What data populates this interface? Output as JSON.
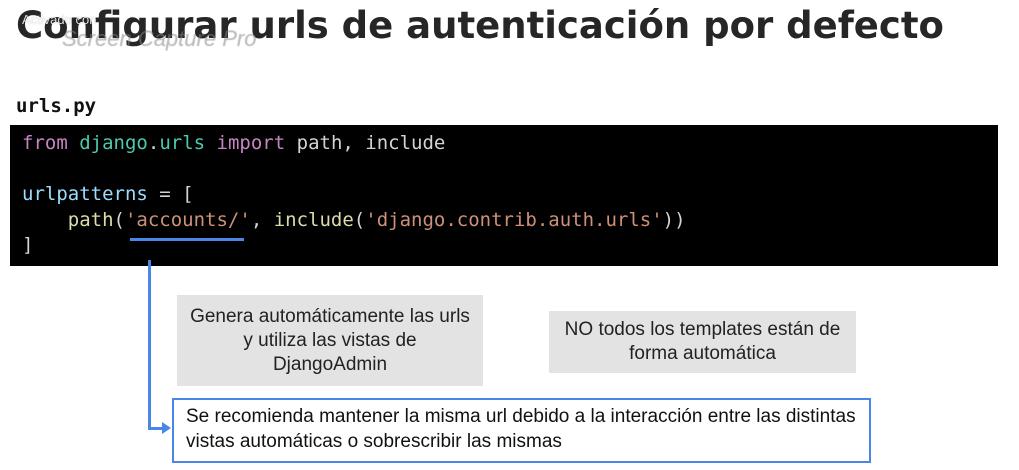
{
  "header": {
    "title": "Configurar urls de autenticación por defecto"
  },
  "watermark": {
    "line1": "Activado con",
    "line2": "Screen Capture Pro"
  },
  "code": {
    "filename": "urls.py",
    "lines": [
      {
        "from": "from",
        "module_a": "django",
        "dot": ".",
        "module_b": "urls",
        "imp": "import",
        "names": "path, include"
      },
      {
        "blank": ""
      },
      {
        "var": "urlpatterns",
        "rest": " = ["
      },
      {
        "indent": "    ",
        "fn1": "path",
        "p1": "(",
        "s1": "'accounts/'",
        "c": ", ",
        "fn2": "include",
        "p2": "(",
        "s2": "'django.contrib.auth.urls'",
        "p3": "))"
      },
      {
        "close": "]"
      }
    ]
  },
  "notes": {
    "auto_urls": "Genera automáticamente las urls y utiliza las vistas de DjangoAdmin",
    "templates": "NO todos los templates están de forma automática",
    "recommendation": "Se recomienda mantener la misma url debido a la interacción entre las distintas vistas automáticas o sobrescribir las mismas"
  },
  "colors": {
    "accent": "#4a86e8",
    "code_bg": "#000000",
    "note_bg": "#e3e3e3"
  }
}
